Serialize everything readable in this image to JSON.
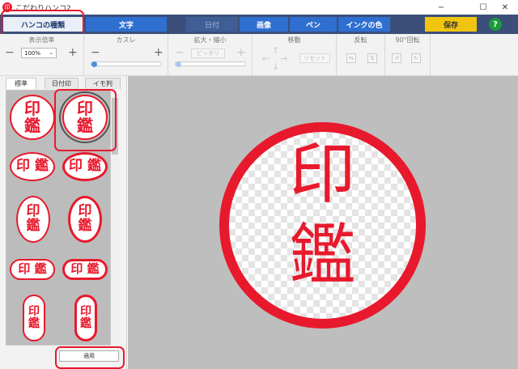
{
  "window": {
    "title": "こだわりハンコ2",
    "app_icon_glyph": "印",
    "controls": {
      "minimize": "−",
      "maximize": "☐",
      "close": "✕"
    }
  },
  "menu": {
    "tabs": [
      {
        "label": "ハンコの種類",
        "state": "active"
      },
      {
        "label": "文字",
        "state": "normal"
      },
      {
        "label": "日付",
        "state": "disabled"
      },
      {
        "label": "画像",
        "state": "normal"
      },
      {
        "label": "ペン",
        "state": "normal"
      },
      {
        "label": "インクの色",
        "state": "normal"
      }
    ],
    "save_label": "保存",
    "help_label": "?"
  },
  "toolbar": {
    "display_size_label": "表示倍率",
    "zoom_value": "100%",
    "blur_label": "カスレ",
    "scale_label": "拡大・縮小",
    "fit_button": "ピッタリ",
    "move_label": "移動",
    "reset_button": "リセット",
    "flip_label": "反転",
    "rotate_label": "90°回転",
    "minus": "−",
    "plus": "+"
  },
  "sidebar": {
    "tabs": [
      {
        "label": "標準",
        "active": true
      },
      {
        "label": "日付印",
        "active": false
      },
      {
        "label": "イモ判",
        "active": false
      }
    ],
    "stamp_text_top": "印",
    "stamp_text_bottom": "鑑",
    "apply_button": "適用"
  },
  "canvas": {
    "stamp_text_top": "印",
    "stamp_text_bottom": "鑑"
  },
  "colors": {
    "accent_red": "#e8192c",
    "menubar": "#3b4f7a",
    "tab_blue": "#2f6fd0",
    "save_yellow": "#f1c40f",
    "help_green": "#1b9b3a"
  }
}
